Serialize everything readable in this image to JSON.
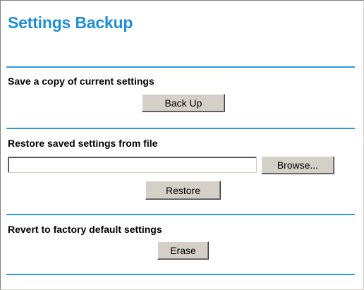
{
  "page": {
    "title": "Settings Backup"
  },
  "backup": {
    "label": "Save a copy of current settings",
    "button_label": "Back Up"
  },
  "restore": {
    "label": "Restore saved settings from file",
    "file_value": "",
    "browse_label": "Browse...",
    "button_label": "Restore"
  },
  "revert": {
    "label": "Revert to factory default settings",
    "button_label": "Erase"
  },
  "colors": {
    "title": "#1e8fd8",
    "rule": "#2b9bdd",
    "button_face": "#d4d0c8"
  }
}
